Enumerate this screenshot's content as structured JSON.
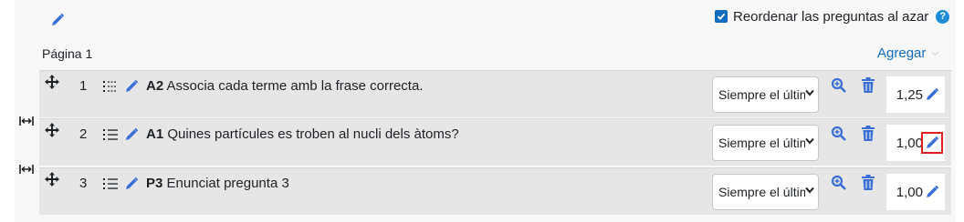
{
  "header": {
    "shuffle_label": "Reordenar las preguntas al azar",
    "shuffle_checked": true,
    "help_glyph": "?",
    "edit_icon": "pencil-icon"
  },
  "page": {
    "label": "Página 1",
    "add_label": "Agregar",
    "add_arrow": "⌵"
  },
  "questions": [
    {
      "number": "1",
      "code": "A2",
      "text": "Associa cada terme amb la frase correcta.",
      "dependency": "Siempre el últim",
      "mark": "1,25",
      "type_icon": "matching-icon"
    },
    {
      "number": "2",
      "code": "A1",
      "text": "Quines partícules es troben al nucli dels àtoms?",
      "dependency": "Siempre el últim",
      "mark": "1,00",
      "type_icon": "multichoice-icon"
    },
    {
      "number": "3",
      "code": "P3",
      "text": "Enunciat pregunta 3",
      "dependency": "Siempre el últim",
      "mark": "1,00",
      "type_icon": "multichoice-icon"
    }
  ],
  "colors": {
    "accent": "#0f6cbf",
    "icon_blue": "#3a6fd8",
    "highlight": "#e02020",
    "row_bg": "#e6e6e6"
  }
}
